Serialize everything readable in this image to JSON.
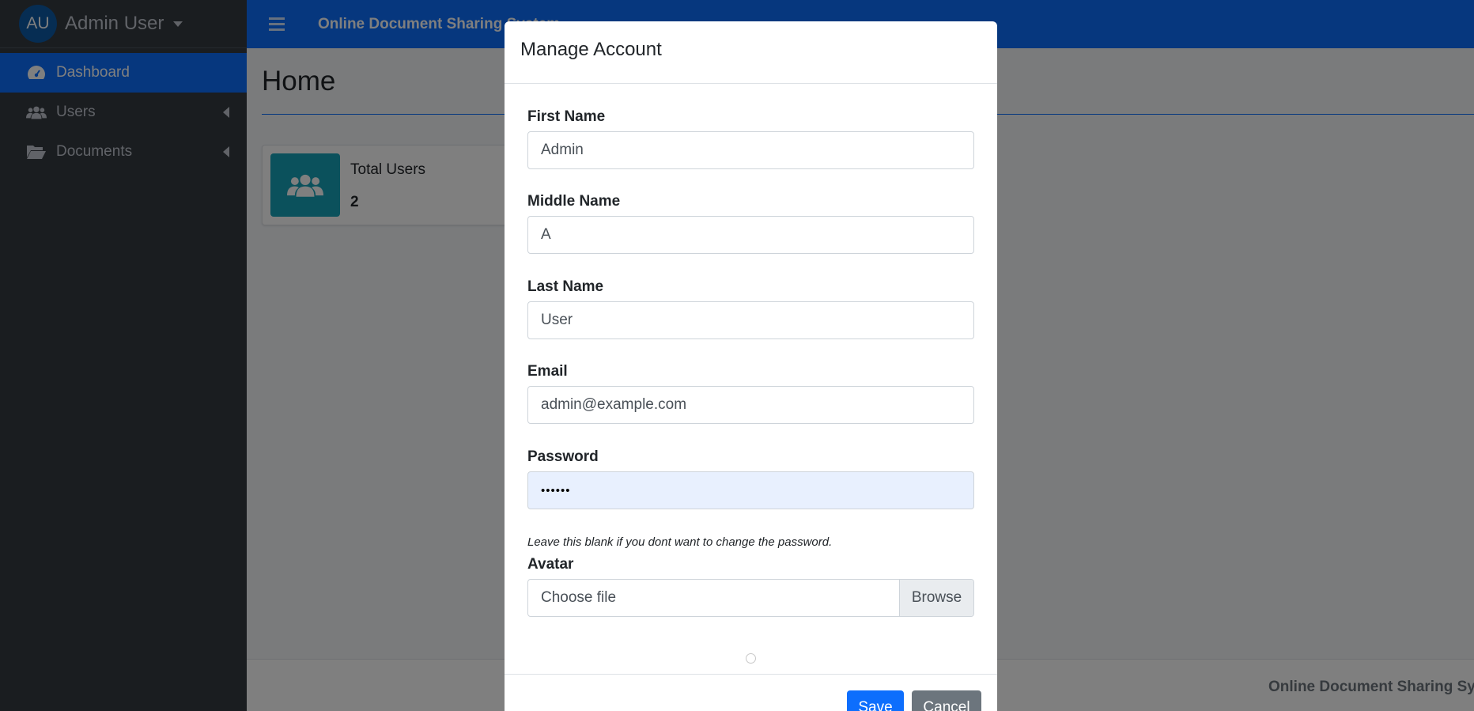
{
  "sidebar": {
    "user_initials": "AU",
    "user_name": "Admin User",
    "items": [
      {
        "label": "Dashboard",
        "icon": "dashboard-icon",
        "active": true
      },
      {
        "label": "Users",
        "icon": "users-icon",
        "active": false
      },
      {
        "label": "Documents",
        "icon": "folder-open-icon",
        "active": false
      }
    ]
  },
  "topbar": {
    "brand": "Online Document Sharing System"
  },
  "main": {
    "title": "Home",
    "info_box": {
      "label": "Total Users",
      "value": "2",
      "icon": "users-icon"
    },
    "footer_text": "Online Document Sharing System"
  },
  "modal": {
    "title": "Manage Account",
    "fields": {
      "first_name": {
        "label": "First Name",
        "value": "Admin"
      },
      "middle_name": {
        "label": "Middle Name",
        "value": "A"
      },
      "last_name": {
        "label": "Last Name",
        "value": "User"
      },
      "email": {
        "label": "Email",
        "value": "admin@example.com"
      },
      "password": {
        "label": "Password",
        "value": "••••••",
        "help": "Leave this blank if you dont want to change the password."
      },
      "avatar": {
        "label": "Avatar",
        "placeholder": "Choose file",
        "browse": "Browse"
      }
    },
    "save_label": "Save",
    "cancel_label": "Cancel"
  },
  "colors": {
    "primary": "#0d6efd",
    "sidebar": "#343a40",
    "info": "#17a2b8",
    "secondary": "#6c757d",
    "autofill": "#e8f0fe"
  }
}
